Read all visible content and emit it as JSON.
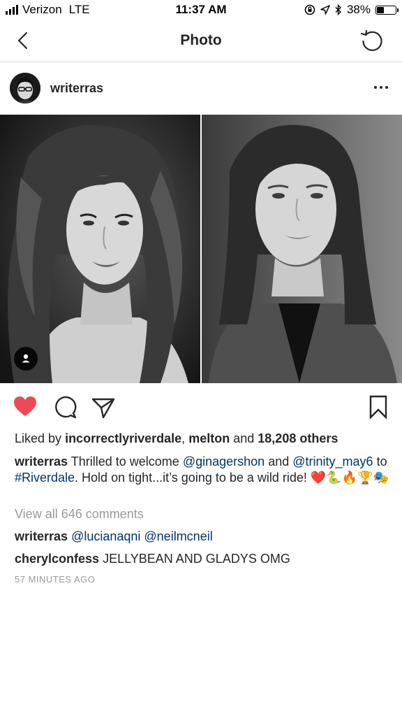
{
  "status_bar": {
    "carrier": "Verizon",
    "network": "LTE",
    "time": "11:37 AM",
    "battery": "38%",
    "battery_level": 0.38
  },
  "nav": {
    "title": "Photo"
  },
  "post": {
    "username": "writerras",
    "likes": {
      "prefix": "Liked by",
      "user1": "incorrectlyriverdale",
      "sep": ",",
      "user2": "melton",
      "and": "and",
      "count": "18,208 others"
    },
    "caption": {
      "author": "writerras",
      "text1": "Thrilled to welcome",
      "mention1": "@ginagershon",
      "text2": "and",
      "mention2": "@trinity_may6",
      "text3": "to",
      "hashtag": "#Riverdale",
      "text4": ". Hold on tight...it’s going to be a wild ride!",
      "emojis": "❤️🐍🔥🏆🎭"
    },
    "view_all_comments": "View all 646 comments",
    "comments": [
      {
        "author": "writerras",
        "mentions": "@lucianaqni @neilmcneil",
        "text": ""
      },
      {
        "author": "cherylconfess",
        "mentions": "",
        "text": "JELLYBEAN AND GLADYS OMG"
      }
    ],
    "time_ago": "57 MINUTES AGO",
    "liked": true
  },
  "icons": {
    "back": "chevron-left-icon",
    "refresh": "refresh-icon",
    "more": "more-options-icon",
    "like": "heart-icon",
    "comment": "comment-icon",
    "share": "share-icon",
    "save": "bookmark-icon",
    "tag": "user-tag-icon"
  },
  "colors": {
    "like_red": "#ed4956",
    "link_blue": "#003569",
    "muted": "#999999",
    "text": "#262626"
  }
}
